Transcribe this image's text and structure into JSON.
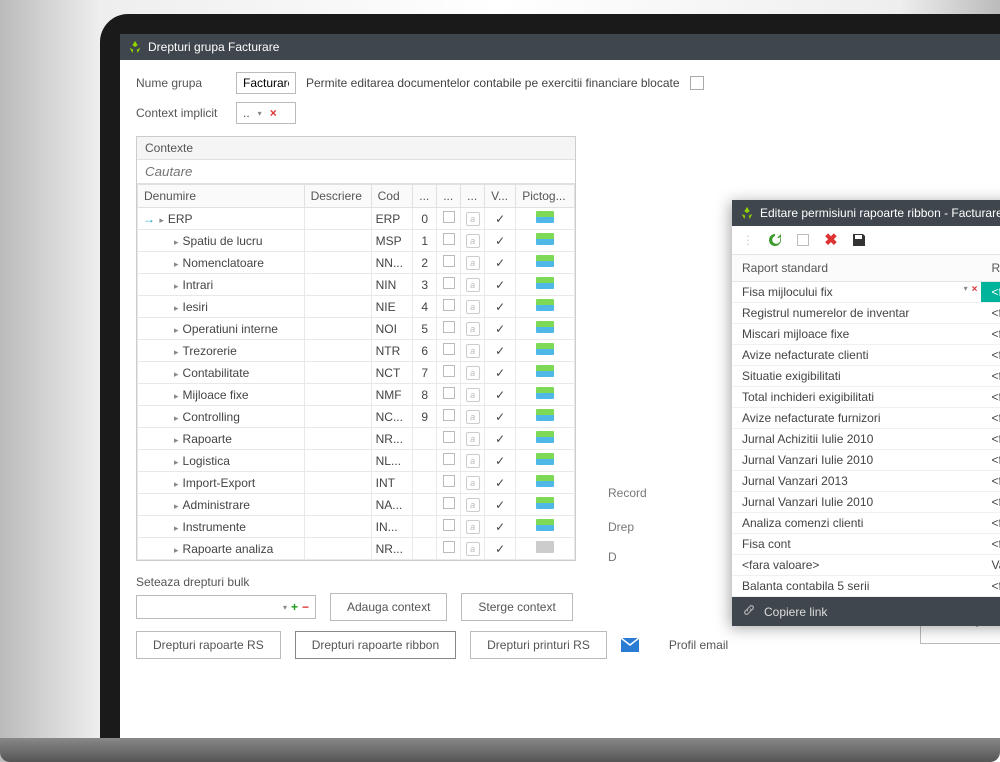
{
  "window": {
    "title": "Drepturi grupa Facturare"
  },
  "form": {
    "nume_grupa_label": "Nume grupa",
    "nume_grupa_value": "Facturare",
    "permite_label": "Permite editarea documentelor contabile pe exercitii financiare blocate",
    "context_label": "Context implicit",
    "context_value": ".."
  },
  "panel": {
    "title": "Contexte",
    "search_placeholder": "Cautare"
  },
  "columns": {
    "denumire": "Denumire",
    "descriere": "Descriere",
    "cod": "Cod",
    "c4": "...",
    "c5": "...",
    "c6": "...",
    "c7": "V...",
    "picto": "Pictog..."
  },
  "rows": [
    {
      "name": "ERP",
      "cod": "ERP",
      "idx": "0",
      "root": true
    },
    {
      "name": "Spatiu de lucru",
      "cod": "MSP",
      "idx": "1"
    },
    {
      "name": "Nomenclatoare",
      "cod": "NN...",
      "idx": "2"
    },
    {
      "name": "Intrari",
      "cod": "NIN",
      "idx": "3"
    },
    {
      "name": "Iesiri",
      "cod": "NIE",
      "idx": "4"
    },
    {
      "name": "Operatiuni interne",
      "cod": "NOI",
      "idx": "5"
    },
    {
      "name": "Trezorerie",
      "cod": "NTR",
      "idx": "6"
    },
    {
      "name": "Contabilitate",
      "cod": "NCT",
      "idx": "7"
    },
    {
      "name": "Mijloace fixe",
      "cod": "NMF",
      "idx": "8"
    },
    {
      "name": "Controlling",
      "cod": "NC...",
      "idx": "9"
    },
    {
      "name": "Rapoarte",
      "cod": "NR...",
      "idx": ""
    },
    {
      "name": "Logistica",
      "cod": "NL...",
      "idx": ""
    },
    {
      "name": "Import-Export",
      "cod": "INT",
      "idx": ""
    },
    {
      "name": "Administrare",
      "cod": "NA...",
      "idx": ""
    },
    {
      "name": "Instrumente",
      "cod": "IN...",
      "idx": ""
    },
    {
      "name": "Rapoarte analiza",
      "cod": "NR...",
      "idx": "",
      "dim": true
    }
  ],
  "bulk": {
    "label": "Seteaza drepturi bulk",
    "add_context": "Adauga context",
    "del_context": "Sterge context"
  },
  "bottom": {
    "b1": "Drepturi rapoarte RS",
    "b2": "Drepturi rapoarte ribbon",
    "b3": "Drepturi printuri RS",
    "b4": "Profil email"
  },
  "right_fragments": {
    "record": "Record",
    "drep": "Drep",
    "d": "D",
    "lt": "<"
  },
  "overlay": {
    "title": "Editare permisiuni rapoarte ribbon - Facturare",
    "col1": "Raport standard",
    "col2": "Raport custom",
    "footer": "Copiere link",
    "empty": "<fara valoare>",
    "rows": [
      {
        "std": "Fisa mijlocului fix",
        "cust": "<fara valoare>",
        "hl": true
      },
      {
        "std": "Registrul numerelor de inventar",
        "cust": "<fara valoare>"
      },
      {
        "std": "Miscari mijloace fixe",
        "cust": "<fara valoare>"
      },
      {
        "std": "Avize nefacturate clienti",
        "cust": "<fara valoare>"
      },
      {
        "std": "Situatie exigibilitati",
        "cust": "<fara valoare>"
      },
      {
        "std": "Total inchideri exigibilitati",
        "cust": "<fara valoare>"
      },
      {
        "std": "Avize nefacturate furnizori",
        "cust": "<fara valoare>"
      },
      {
        "std": "Jurnal Achizitii Iulie 2010",
        "cust": "<fara valoare>"
      },
      {
        "std": "Jurnal Vanzari Iulie 2010",
        "cust": "<fara valoare>"
      },
      {
        "std": "Jurnal Vanzari 2013",
        "cust": "<fara valoare>"
      },
      {
        "std": "Jurnal Vanzari Iulie 2010",
        "cust": "<fara valoare>"
      },
      {
        "std": "Analiza comenzi clienti",
        "cust": "<fara valoare>"
      },
      {
        "std": "Fisa cont",
        "cust": "<fara valoare>"
      },
      {
        "std": "<fara valoare>",
        "cust": "Vanzari FC"
      },
      {
        "std": "Balanta contabila 5 serii",
        "cust": "<fara valoare>"
      }
    ]
  }
}
